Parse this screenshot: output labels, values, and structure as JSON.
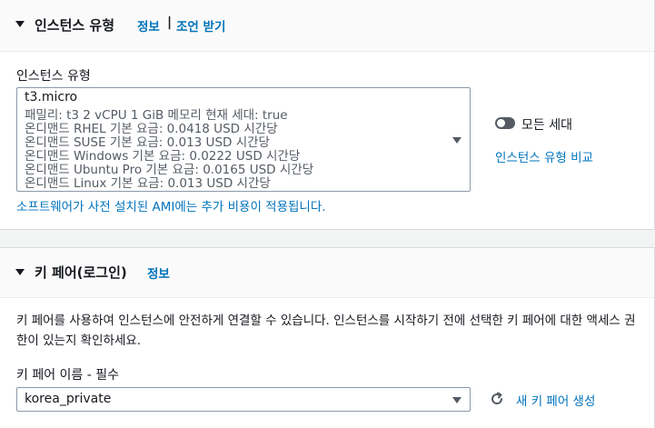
{
  "instance_type_section": {
    "title": "인스턴스 유형",
    "info_link": "정보",
    "separator": "|",
    "advice_link": "조언 받기",
    "field_label": "인스턴스 유형",
    "selected": {
      "name": "t3.micro",
      "details": [
        "패밀리: t3    2 vCPU    1 GiB 메모리    현재 세대: true",
        "온디맨드 RHEL 기본 요금: 0.0418 USD 시간당",
        "온디맨드 SUSE 기본 요금: 0.013 USD 시간당",
        "온디맨드 Windows 기본 요금: 0.0222 USD 시간당",
        "온디맨드 Ubuntu Pro 기본 요금: 0.0165 USD 시간당",
        "온디맨드 Linux 기본 요금: 0.013 USD 시간당"
      ]
    },
    "all_generations_label": "모든 세대",
    "all_generations_enabled": false,
    "compare_link": "인스턴스 유형 비교",
    "ami_note": "소프트웨어가 사전 설치된 AMI에는 추가 비용이 적용됩니다."
  },
  "key_pair_section": {
    "title": "키 페어(로그인)",
    "info_link": "정보",
    "description": "키 페어를 사용하여 인스턴스에 안전하게 연결할 수 있습니다. 인스턴스를 시작하기 전에 선택한 키 페어에 대한 액세스 권한이 있는지 확인하세요.",
    "field_label": "키 페어 이름 - 필수",
    "selected": "korea_private",
    "create_link": "새 키 페어 생성"
  },
  "icons": {
    "section_toggle": "caret-down-icon",
    "dropdown": "dropdown-caret-icon",
    "refresh": "refresh-icon"
  },
  "colors": {
    "link": "#0073bb",
    "background": "#f2f3f3",
    "panel": "#ffffff",
    "toggle_off": "#545b64"
  }
}
